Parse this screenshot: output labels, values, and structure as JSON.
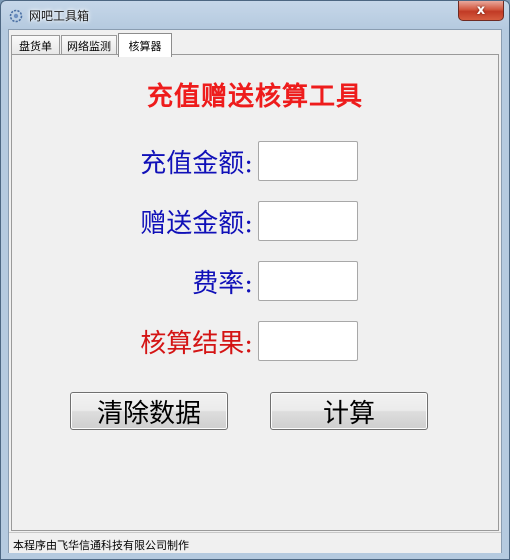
{
  "window": {
    "title": "网吧工具箱",
    "close_symbol": "x"
  },
  "tabs": [
    {
      "label": "盘货单",
      "active": false
    },
    {
      "label": "网络监测",
      "active": false
    },
    {
      "label": "核算器",
      "active": true
    }
  ],
  "calculator": {
    "heading": "充值赠送核算工具",
    "recharge_label": "充值金额:",
    "recharge_value": "",
    "bonus_label": "赠送金额:",
    "bonus_value": "",
    "rate_label": "费率:",
    "rate_value": "",
    "result_label": "核算结果:",
    "result_value": "",
    "clear_button": "清除数据",
    "calculate_button": "计算"
  },
  "statusbar": {
    "text": "本程序由飞华信通科技有限公司制作"
  },
  "colors": {
    "heading": "#ee1c1c",
    "label_blue": "#1010b8",
    "label_red": "#d41414"
  },
  "icons": {
    "app": "gear-app-icon"
  }
}
